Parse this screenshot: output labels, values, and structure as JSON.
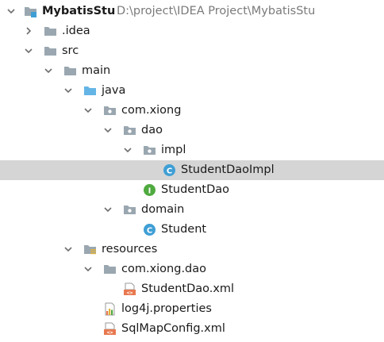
{
  "colors": {
    "folder": "#9aa7b0",
    "source_folder": "#64b5e6",
    "class_icon": "#3f9fd5",
    "interface_icon": "#4faa3f",
    "selection": "#d5d5d5",
    "xml_icon": "#e8784f"
  },
  "tree": {
    "project": {
      "name": "MybatisStu",
      "path": "D:\\project\\IDEA Project\\MybatisStu",
      "icon": "module-folder-icon"
    },
    "idea": {
      "name": ".idea",
      "icon": "folder-icon"
    },
    "src": {
      "name": "src",
      "icon": "folder-icon"
    },
    "main": {
      "name": "main",
      "icon": "folder-icon"
    },
    "java": {
      "name": "java",
      "icon": "source-root-folder-icon"
    },
    "package": {
      "name": "com.xiong",
      "icon": "package-icon"
    },
    "dao": {
      "name": "dao",
      "icon": "package-icon"
    },
    "impl": {
      "name": "impl",
      "icon": "package-icon"
    },
    "studentDaoImpl": {
      "name": "StudentDaoImpl",
      "icon": "class-icon",
      "badge": "C"
    },
    "studentDao": {
      "name": "StudentDao",
      "icon": "interface-icon",
      "badge": "I"
    },
    "domain": {
      "name": "domain",
      "icon": "package-icon"
    },
    "student": {
      "name": "Student",
      "icon": "class-icon",
      "badge": "C"
    },
    "resources": {
      "name": "resources",
      "icon": "resources-folder-icon"
    },
    "resPackage": {
      "name": "com.xiong.dao",
      "icon": "folder-icon"
    },
    "studentDaoXml": {
      "name": "StudentDao.xml",
      "icon": "xml-file-icon",
      "badge": "<>"
    },
    "log4j": {
      "name": "log4j.properties",
      "icon": "properties-file-icon"
    },
    "sqlMapConfig": {
      "name": "SqlMapConfig.xml",
      "icon": "xml-file-icon",
      "badge": "<>"
    }
  }
}
